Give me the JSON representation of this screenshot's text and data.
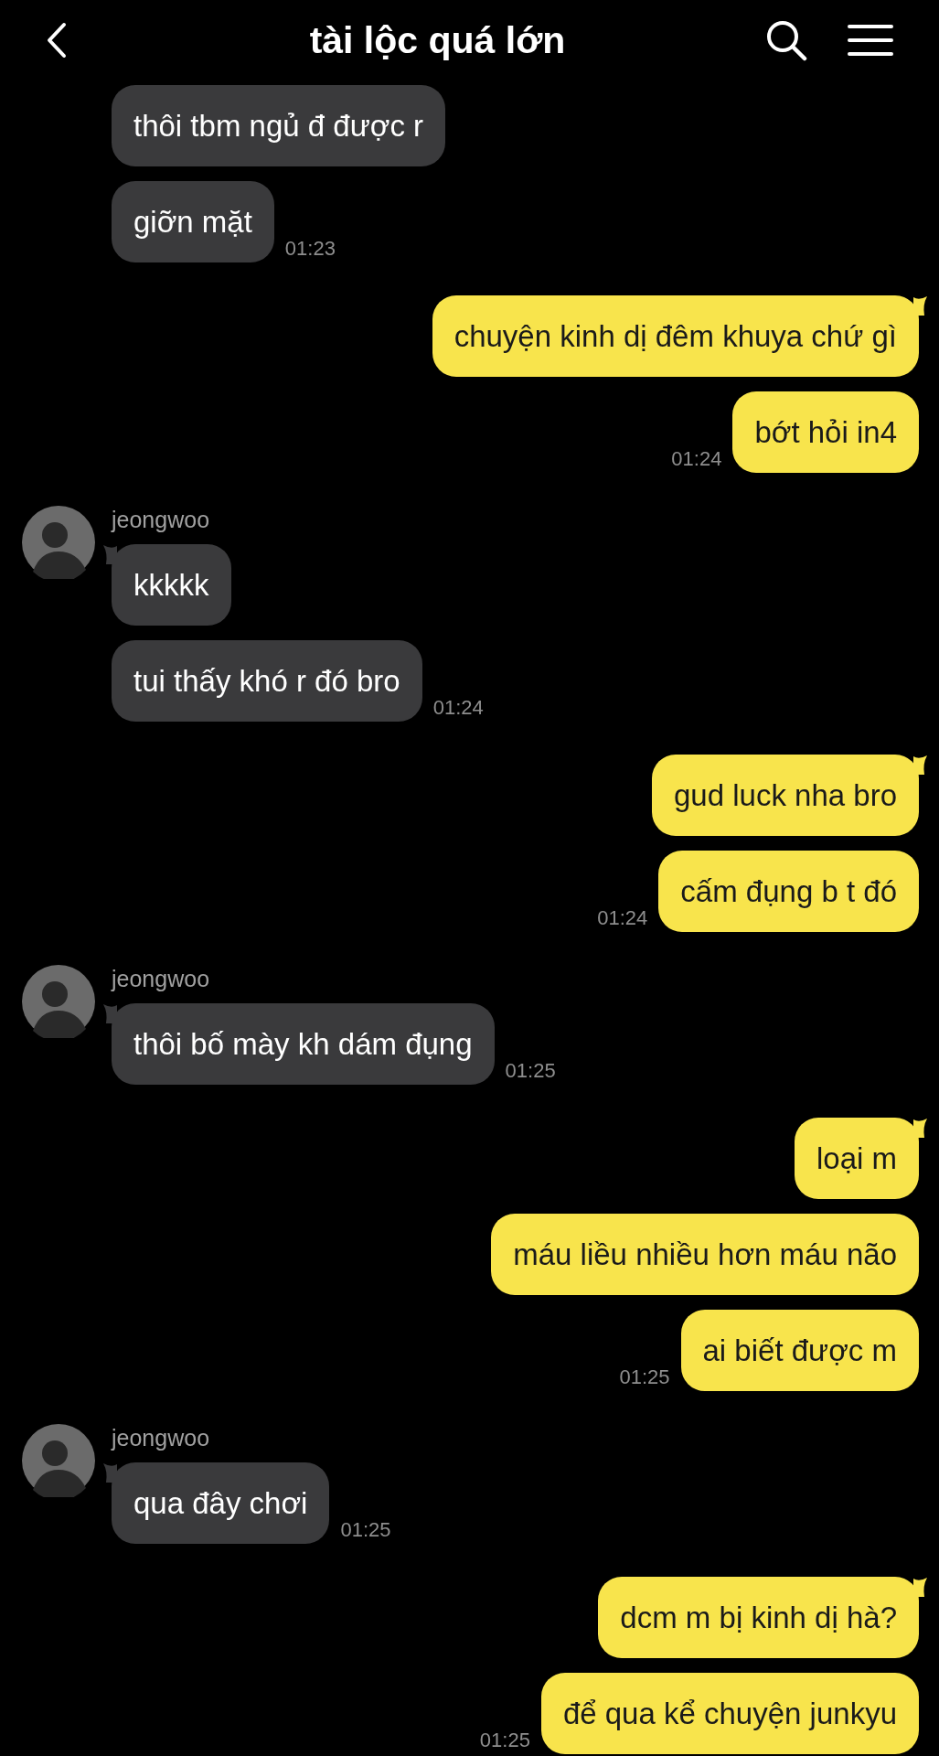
{
  "header": {
    "title": "tài lộc quá lớn"
  },
  "groups": [
    {
      "kind": "incoming",
      "messages": [
        {
          "text": "thôi tbm ngủ đ được r"
        },
        {
          "text": "giỡn mặt",
          "time": "01:23"
        }
      ]
    },
    {
      "kind": "outgoing",
      "messages": [
        {
          "text": "chuyện kinh dị đêm khuya chứ gì"
        },
        {
          "text": "bớt hỏi in4",
          "time": "01:24"
        }
      ]
    },
    {
      "kind": "incoming",
      "sender": "jeongwoo",
      "messages": [
        {
          "text": "kkkkk"
        },
        {
          "text": "tui thấy khó r đó bro",
          "time": "01:24"
        }
      ]
    },
    {
      "kind": "outgoing",
      "messages": [
        {
          "text": "gud luck nha bro"
        },
        {
          "text": "cấm đụng b t đó",
          "time": "01:24"
        }
      ]
    },
    {
      "kind": "incoming",
      "sender": "jeongwoo",
      "messages": [
        {
          "text": "thôi bố mày kh dám đụng",
          "time": "01:25"
        }
      ]
    },
    {
      "kind": "outgoing",
      "messages": [
        {
          "text": "loại m"
        },
        {
          "text": "máu liều nhiều hơn máu não"
        },
        {
          "text": "ai biết được m",
          "time": "01:25"
        }
      ]
    },
    {
      "kind": "incoming",
      "sender": "jeongwoo",
      "messages": [
        {
          "text": "qua đây chơi",
          "time": "01:25"
        }
      ]
    },
    {
      "kind": "outgoing",
      "messages": [
        {
          "text": "dcm m bị kinh dị hà?"
        },
        {
          "text": "để qua kể chuyện junkyu",
          "time": "01:25"
        }
      ]
    }
  ]
}
